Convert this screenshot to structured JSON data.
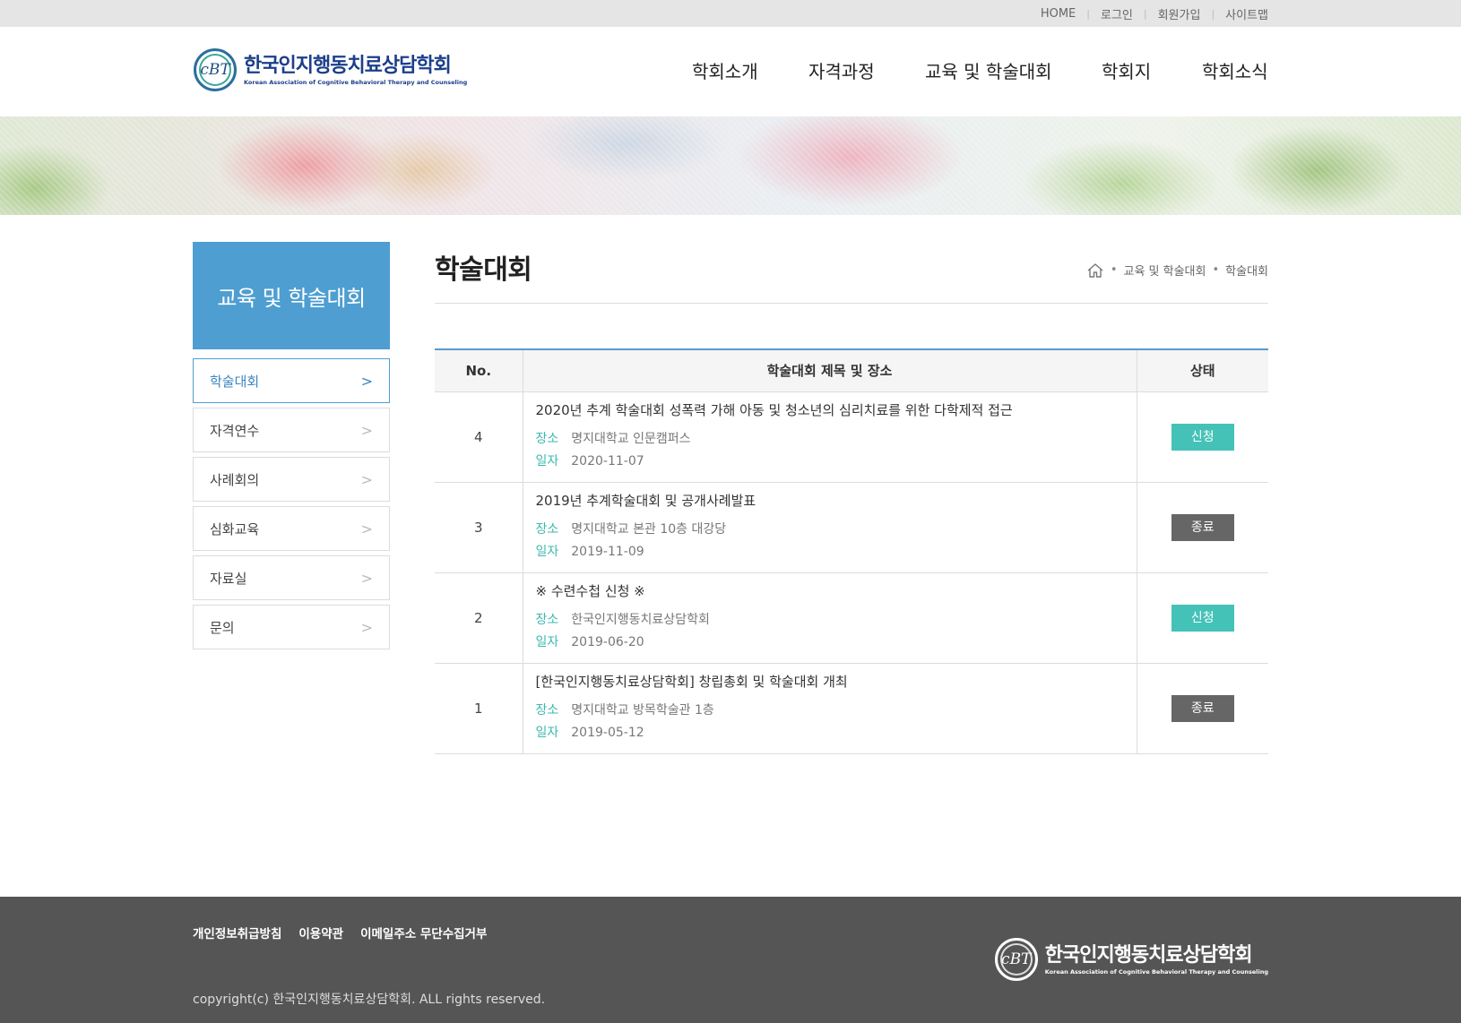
{
  "util_links": [
    "HOME",
    "로그인",
    "회원가입",
    "사이트맵"
  ],
  "logo": {
    "mark": "cBT",
    "name_ko": "한국인지행동치료상담학회",
    "name_en": "Korean Association of Cognitive Behavioral Therapy and Counseling"
  },
  "gnb": [
    "학회소개",
    "자격과정",
    "교육 및 학술대회",
    "학회지",
    "학회소식"
  ],
  "lnb": {
    "title": "교육 및 학술대회",
    "items": [
      {
        "label": "학술대회",
        "active": true
      },
      {
        "label": "자격연수",
        "active": false
      },
      {
        "label": "사례회의",
        "active": false
      },
      {
        "label": "심화교육",
        "active": false
      },
      {
        "label": "자료실",
        "active": false
      },
      {
        "label": "문의",
        "active": false
      }
    ]
  },
  "page": {
    "title": "학술대회",
    "breadcrumb": [
      "교육 및 학술대회",
      "학술대회"
    ]
  },
  "table": {
    "headers": [
      "No.",
      "학술대회 제목 및 장소",
      "상태"
    ],
    "place_label": "장소",
    "date_label": "일자",
    "rows": [
      {
        "no": "4",
        "title": "2020년 추계 학술대회 성폭력 가해 아동 및 청소년의 심리치료를 위한 다학제적 접근",
        "place": "명지대학교 인문캠퍼스",
        "date": "2020-11-07",
        "status": "신청",
        "status_color": "#45c2b8"
      },
      {
        "no": "3",
        "title": "2019년 추계학술대회 및 공개사례발표",
        "place": "명지대학교 본관 10층 대강당",
        "date": "2019-11-09",
        "status": "종료",
        "status_color": "#666666"
      },
      {
        "no": "2",
        "title": "※ 수련수첩 신청 ※",
        "place": "한국인지행동치료상담학회",
        "date": "2019-06-20",
        "status": "신청",
        "status_color": "#45c2b8"
      },
      {
        "no": "1",
        "title": "[한국인지행동치료상담학회] 창립총회 및 학술대회 개최",
        "place": "명지대학교 방목학술관 1층",
        "date": "2019-05-12",
        "status": "종료",
        "status_color": "#666666"
      }
    ]
  },
  "footer": {
    "links": [
      "개인정보취급방침",
      "이용약관",
      "이메일주소 무단수집거부"
    ],
    "copyright": "copyright(c) 한국인지행동치료상담학회. ALL rights reserved."
  },
  "colors": {
    "accent": "#4e9ed1",
    "status_on": "#45c2b8",
    "status_off": "#666666",
    "footer_bg": "#555555"
  }
}
